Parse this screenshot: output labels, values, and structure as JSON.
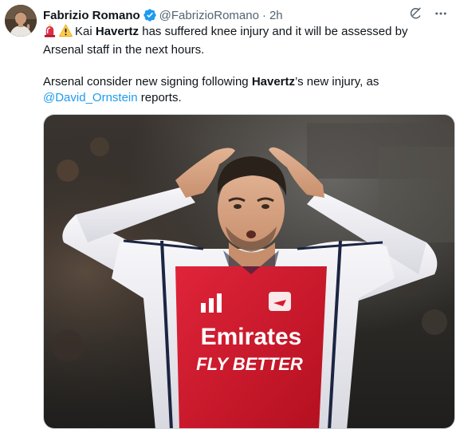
{
  "author": {
    "name": "Fabrizio Romano",
    "handle": "@FabrizioRomano",
    "separator": "·",
    "time": "2h"
  },
  "tweet": {
    "line1_prefix": "Kai ",
    "line1_bold": "Havertz",
    "line1_rest": " has suffered knee injury and it will be assessed by Arsenal staff in the next hours.",
    "line2_prefix": "Arsenal consider new signing following ",
    "line2_bold": "Havertz",
    "line2_rest": "’s new injury, as ",
    "mention": "@David_Ornstein",
    "line2_end": " reports."
  },
  "icons": {
    "emoji1": "siren-icon",
    "emoji2": "warning-icon",
    "verified": "verified-badge-icon",
    "grok": "grok-icon",
    "more": "more-icon"
  },
  "image": {
    "shirt_sponsor_line1": "Emirates",
    "shirt_sponsor_line2": "FLY BETTER"
  },
  "colors": {
    "link": "#1d9bf0",
    "verified": "#1d9bf0",
    "secondary_text": "#536471",
    "arsenal_red": "#d8182e"
  }
}
